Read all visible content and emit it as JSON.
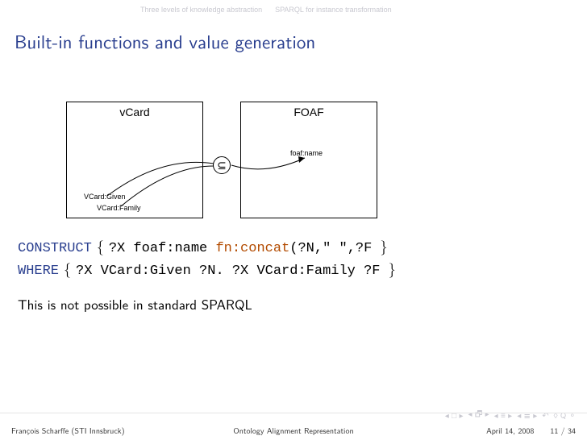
{
  "nav": {
    "sec1": "Three levels of knowledge abstraction",
    "sec2": "SPARQL for instance transformation"
  },
  "title": "Built-in functions and value generation",
  "diagram": {
    "left_box": "vCard",
    "right_box": "FOAF",
    "left_prop1": "VCard:Given",
    "left_prop2": "VCard:Family",
    "right_prop": "foaf:name",
    "subset_symbol": "⊆"
  },
  "code": {
    "line1_kw": "CONSTRUCT",
    "line1_open": " { ",
    "line1_body1": "?X foaf:name ",
    "line1_fn": "fn:concat",
    "line1_body2": "(?N,\" \",?F ",
    "line1_close": "}",
    "line2_kw": "WHERE",
    "line2_open": " { ",
    "line2_body": "?X VCard:Given ?N. ?X VCard:Family ?F ",
    "line2_close": "}"
  },
  "note": "This is not possible in standard SPARQL",
  "footer": {
    "author": "François Scharffe (STI Innsbruck)",
    "title": "Ontology Alignment Representation",
    "date": "April 14, 2008",
    "page": "11 / 34"
  }
}
